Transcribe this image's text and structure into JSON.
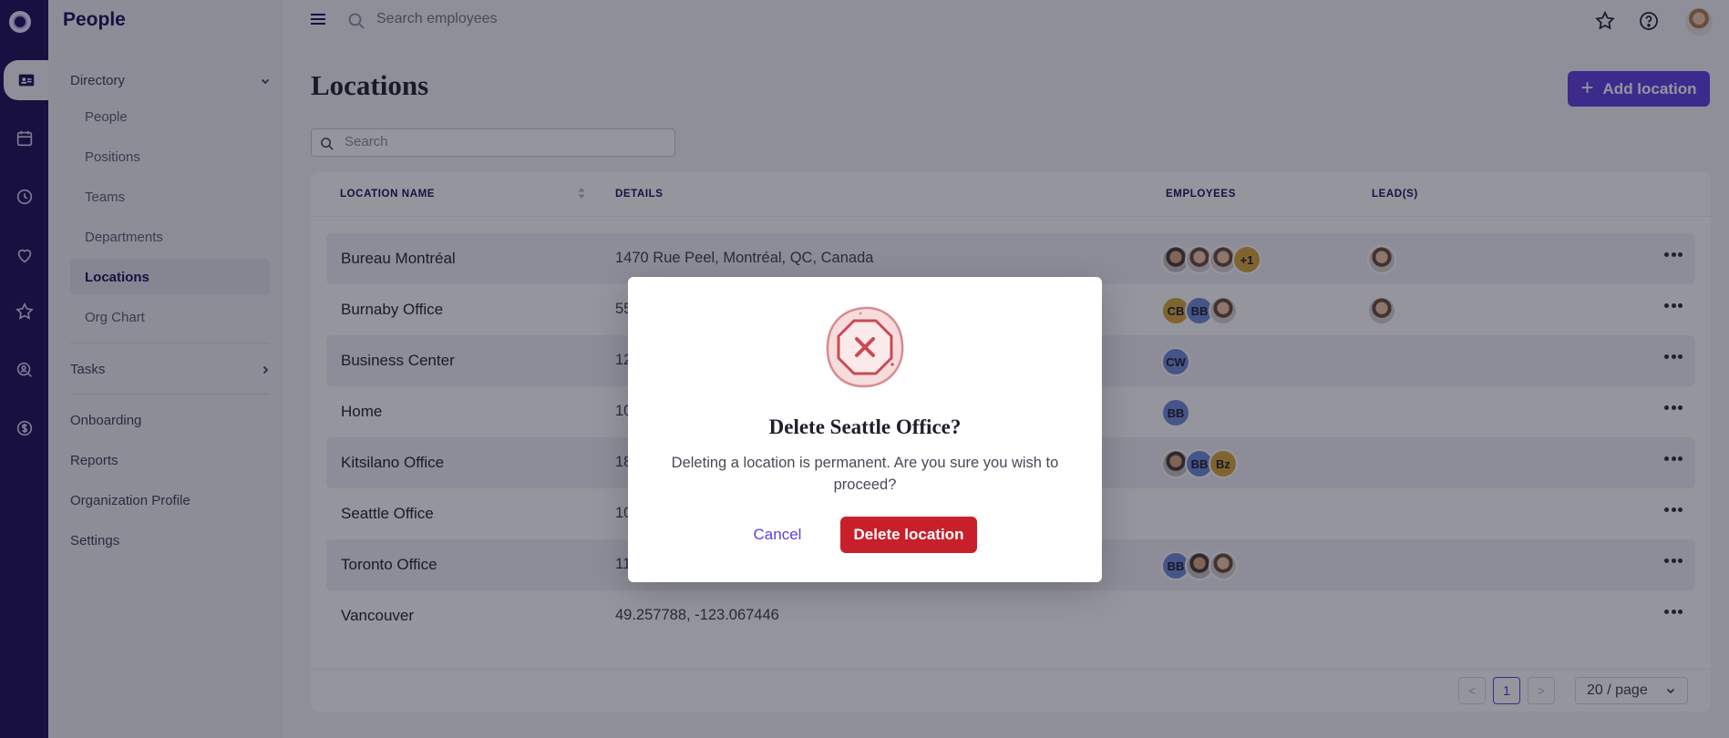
{
  "app": {
    "title": "People"
  },
  "sidebar": {
    "directory_label": "Directory",
    "directory_items": [
      {
        "label": "People"
      },
      {
        "label": "Positions"
      },
      {
        "label": "Teams"
      },
      {
        "label": "Departments"
      },
      {
        "label": "Locations",
        "active": true
      },
      {
        "label": "Org Chart"
      }
    ],
    "tasks_label": "Tasks",
    "bottom_items": [
      {
        "label": "Onboarding"
      },
      {
        "label": "Reports"
      },
      {
        "label": "Organization Profile"
      },
      {
        "label": "Settings"
      }
    ]
  },
  "topbar": {
    "search_placeholder": "Search employees"
  },
  "main": {
    "title": "Locations",
    "add_button_label": "Add location",
    "search_placeholder": "Search",
    "columns": [
      "LOCATION NAME",
      "DETAILS",
      "EMPLOYEES",
      "LEAD(S)"
    ],
    "rows": [
      {
        "name": "Bureau Montréal",
        "details": "1470 Rue Peel, Montréal, QC, Canada",
        "employees": [
          "photo",
          "photo",
          "photo2",
          "+1"
        ],
        "leads": [
          "photo2"
        ]
      },
      {
        "name": "Burnaby Office",
        "details": "55",
        "employees": [
          "CB",
          "BB",
          "photo2"
        ],
        "leads": [
          "photo2"
        ]
      },
      {
        "name": "Business Center",
        "details": "12",
        "employees": [
          "CW"
        ],
        "leads": []
      },
      {
        "name": "Home",
        "details": "10",
        "employees": [
          "BB"
        ],
        "leads": []
      },
      {
        "name": "Kitsilano Office",
        "details": "18",
        "employees": [
          "photo",
          "BB",
          "Bz"
        ],
        "leads": []
      },
      {
        "name": "Seattle Office",
        "details": "10",
        "employees": [],
        "leads": []
      },
      {
        "name": "Toronto Office",
        "details": "11",
        "employees": [
          "BB",
          "photo",
          "photo2"
        ],
        "leads": []
      },
      {
        "name": "Vancouver",
        "details": "49.257788, -123.067446",
        "employees": [],
        "leads": []
      }
    ],
    "pagination": {
      "prev": "<",
      "current_page": "1",
      "next": ">",
      "page_size": "20 / page"
    }
  },
  "modal": {
    "title": "Delete Seattle Office?",
    "message": "Deleting a location is permanent. Are you sure you wish to proceed?",
    "cancel_label": "Cancel",
    "confirm_label": "Delete location",
    "icon": "stop-x-icon"
  },
  "colors": {
    "rail": "#1a0d55",
    "accent": "#5d3fe0",
    "danger": "#c8202a",
    "blue_avatar": "#6f8bd6",
    "gold_avatar": "#d9a635"
  }
}
